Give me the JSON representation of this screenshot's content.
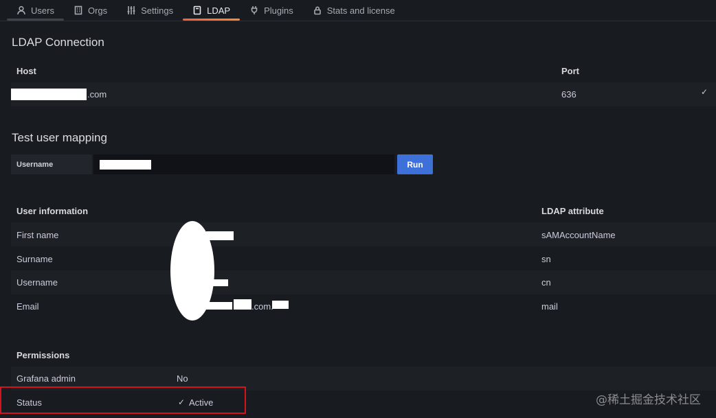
{
  "tabs": [
    {
      "label": "Users",
      "icon": "user-icon"
    },
    {
      "label": "Orgs",
      "icon": "building-icon"
    },
    {
      "label": "Settings",
      "icon": "sliders-icon"
    },
    {
      "label": "LDAP",
      "icon": "book-icon"
    },
    {
      "label": "Plugins",
      "icon": "plug-icon"
    },
    {
      "label": "Stats and license",
      "icon": "lock-icon"
    }
  ],
  "active_tab": "LDAP",
  "ldap_connection": {
    "title": "LDAP Connection",
    "headers": {
      "host": "Host",
      "port": "Port"
    },
    "host_suffix": ".com",
    "port": "636",
    "status_icon": "check-icon"
  },
  "test_mapping": {
    "title": "Test user mapping",
    "username_label": "Username",
    "run_label": "Run"
  },
  "user_info": {
    "headers": {
      "info": "User information",
      "attribute": "LDAP attribute"
    },
    "rows": [
      {
        "label": "First name",
        "attribute": "sAMAccountName"
      },
      {
        "label": "Surname",
        "attribute": "sn"
      },
      {
        "label": "Username",
        "attribute": "cn"
      },
      {
        "label": "Email",
        "attribute": "mail",
        "value_fragment": ".com."
      }
    ]
  },
  "permissions": {
    "header": "Permissions",
    "rows": [
      {
        "label": "Grafana admin",
        "value": "No"
      },
      {
        "label": "Status",
        "value": "Active",
        "icon": "check-icon"
      }
    ]
  },
  "watermark": "@稀土掘金技术社区",
  "colors": {
    "accent": "#3d71d9",
    "highlight": "#d4141c",
    "active_tab_underline": "#f55f3e"
  }
}
